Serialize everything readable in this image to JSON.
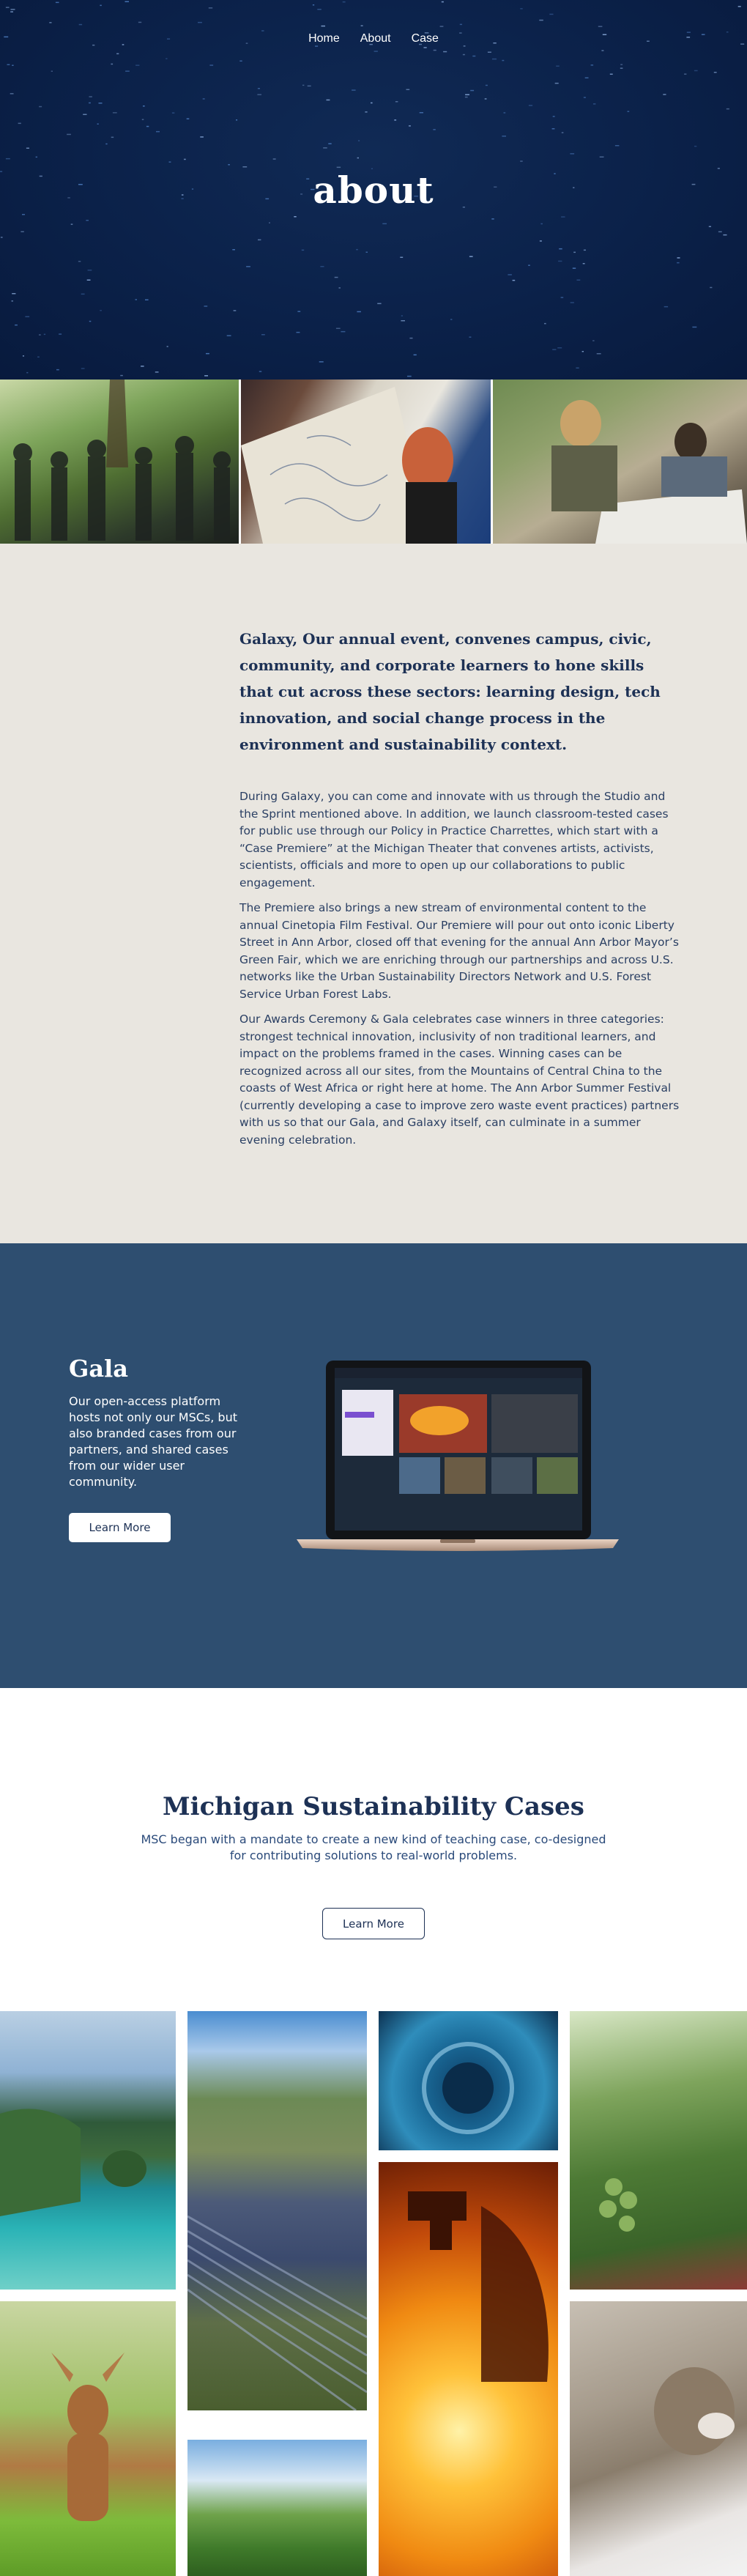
{
  "nav": {
    "items": [
      {
        "label": "Home"
      },
      {
        "label": "About"
      },
      {
        "label": "Case"
      }
    ]
  },
  "hero": {
    "title": "about"
  },
  "about": {
    "lead": "Galaxy, Our annual event, convenes campus, civic, community, and corporate learners to hone skills that cut across these sectors: learning design, tech innovation, and social change process in the environment and sustainability context.",
    "paragraphs": [
      "During Galaxy, you can come and innovate with us through the Studio and the Sprint mentioned above. In addition, we launch classroom-tested cases for public use through our Policy in Practice Charrettes, which start with a “Case Premiere” at the Michigan Theater that convenes artists, activists, scientists, officials and more to open up our collaborations to public engagement.",
      "The Premiere also brings a new stream of environmental content to the annual Cinetopia Film Festival. Our Premiere will pour out onto iconic Liberty Street in Ann Arbor, closed off that evening for the annual Ann Arbor Mayor’s Green Fair, which we are enriching through our partnerships and across U.S. networks like the Urban Sustainability Directors Network and U.S. Forest Service Urban Forest Labs.",
      "Our Awards Ceremony & Gala celebrates case winners in three categories: strongest technical innovation, inclusivity of non traditional learners, and impact on the problems framed in the cases. Winning cases can be recognized across all our sites, from the Mountains of Central China to the coasts of West Africa or right here at home. The Ann Arbor Summer Festival (currently developing a case to improve zero waste event practices) partners with us so that our Gala, and Galaxy itself, can culminate in a summer evening celebration."
    ]
  },
  "gala": {
    "title": "Gala",
    "text": "Our open-access platform hosts not only our MSCs, but also branded cases from our partners, and shared cases from our wider user community.",
    "button_label": "Learn More"
  },
  "msc": {
    "title": "Michigan Sustainability Cases",
    "subtitle": "MSC began with a mandate to create a new kind of teaching case, co-designed for contributing solutions to real-world problems.",
    "button_label": "Learn More"
  },
  "colors": {
    "hero_bg": "#0b2149",
    "about_bg": "#e9e6e0",
    "gala_bg": "#2e4e70",
    "heading": "#1d3155"
  }
}
